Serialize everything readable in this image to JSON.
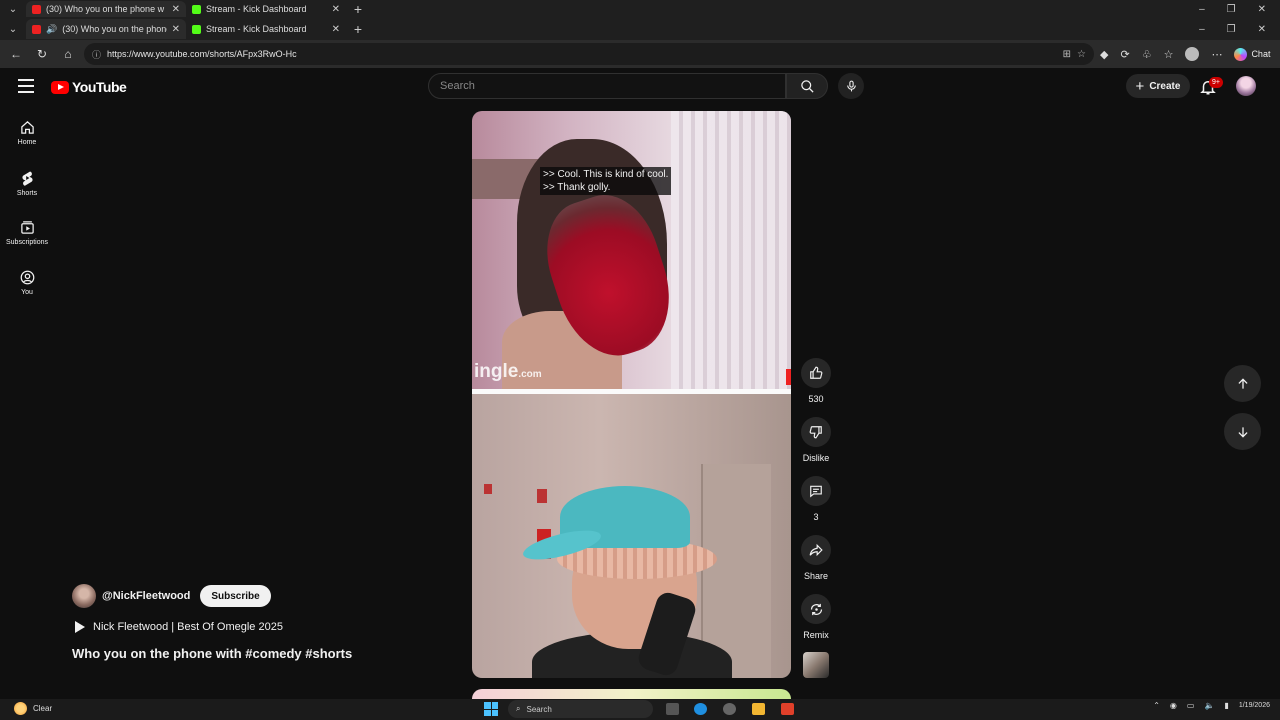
{
  "browser": {
    "tabs_back": [
      {
        "title": "(30) Who you on the phone w",
        "active": false
      },
      {
        "title": "Stream - Kick Dashboard",
        "active": false
      }
    ],
    "tabs": [
      {
        "title": "(30) Who you on the phone w",
        "active": true
      },
      {
        "title": "Stream - Kick Dashboard",
        "active": false
      }
    ],
    "url": "https://www.youtube.com/shorts/AFpx3RwO-Hc",
    "chat_label": "Chat"
  },
  "youtube": {
    "logo_text": "YouTube",
    "search_placeholder": "Search",
    "create_label": "Create",
    "notification_badge": "9+",
    "guide": [
      {
        "label": "Home",
        "icon": "home-icon"
      },
      {
        "label": "Shorts",
        "icon": "shorts-icon"
      },
      {
        "label": "Subscriptions",
        "icon": "subscriptions-icon"
      },
      {
        "label": "You",
        "icon": "you-icon"
      }
    ]
  },
  "short": {
    "captions": [
      ">> Cool. This is kind of cool.",
      ">> Thank golly."
    ],
    "watermark": "ingle",
    "watermark_suffix": ".com",
    "channel": "@NickFleetwood",
    "subscribe_label": "Subscribe",
    "playlist": "Nick Fleetwood | Best Of Omegle 2025",
    "title": "Who you on the phone with #comedy #shorts",
    "actions": {
      "like_count": "530",
      "dislike_label": "Dislike",
      "comment_count": "3",
      "share_label": "Share",
      "remix_label": "Remix"
    }
  },
  "taskbar": {
    "weather": "Clear",
    "search_placeholder": "Search",
    "date": "1/19/2026"
  }
}
